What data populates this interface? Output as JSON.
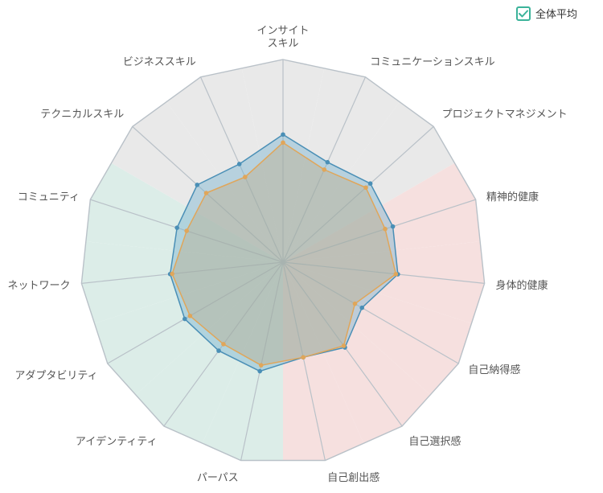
{
  "legend": {
    "label": "全体平均",
    "checked": true
  },
  "colors": {
    "sector_gray": "#e9e9e9",
    "sector_pink": "#f6e0df",
    "sector_green": "#dcede8",
    "grid": "#b9c1c8",
    "series_blue": "#4a8fb6",
    "series_blue_fill": "#79b3d0",
    "series_orange": "#e0a65a",
    "series_orange_fill": "#bfa57a",
    "check": "#3bb39a"
  },
  "chart_data": {
    "type": "radar",
    "max": 100,
    "categories": [
      [
        "インサイト",
        "スキル"
      ],
      [
        "コミュニケーションスキル"
      ],
      [
        "プロジェクトマネジメント"
      ],
      [
        "精神的健康"
      ],
      [
        "身体的健康"
      ],
      [
        "自己納得感"
      ],
      [
        "自己選択感"
      ],
      [
        "自己創出感"
      ],
      [
        "パーパス"
      ],
      [
        "アイデンティティ"
      ],
      [
        "アダプタビリティ"
      ],
      [
        "ネットワーク"
      ],
      [
        "コミュニティ"
      ],
      [
        "テクニカルスキル"
      ],
      [
        "ビジネススキル"
      ]
    ],
    "sector_groups": [
      "gray",
      "gray",
      "gray",
      "pink",
      "pink",
      "pink",
      "pink",
      "pink",
      "green",
      "green",
      "green",
      "green",
      "green",
      "gray",
      "gray"
    ],
    "series": [
      {
        "values": [
          63,
          54,
          58,
          57,
          57,
          45,
          52,
          48,
          55,
          54,
          56,
          56,
          55,
          57,
          53
        ],
        "color": "blue"
      },
      {
        "values": [
          59,
          50,
          55,
          53,
          56,
          41,
          51,
          48,
          52,
          50,
          53,
          55,
          50,
          51,
          46
        ],
        "color": "orange",
        "legend": true
      }
    ]
  }
}
